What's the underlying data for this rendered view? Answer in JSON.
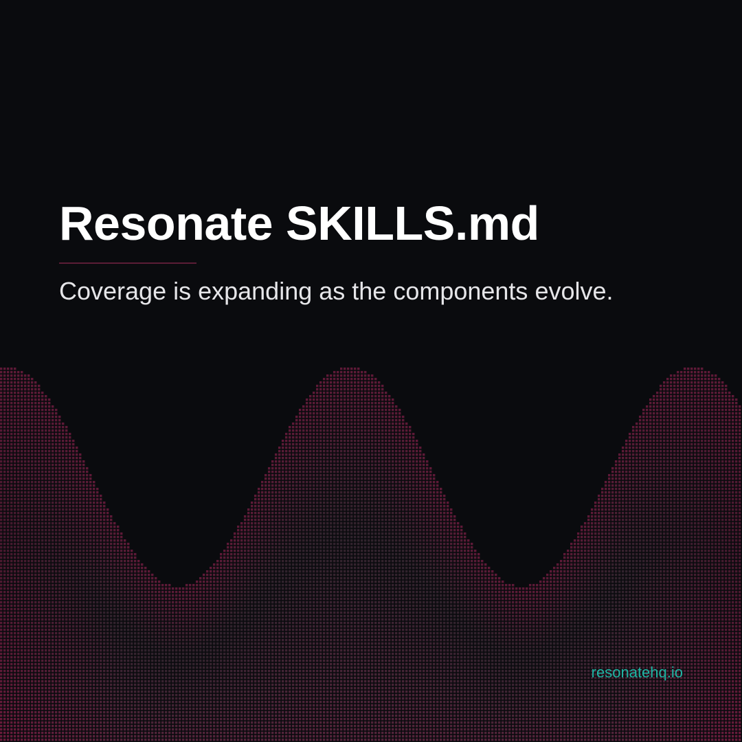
{
  "slide": {
    "title": "Resonate SKILLS.md",
    "subtitle": "Coverage is expanding as the components evolve.",
    "site_link": "resonatehq.io"
  },
  "colors": {
    "background": "#0a0b0e",
    "title": "#ffffff",
    "subtitle": "#e6e6e9",
    "divider": "#5b1d36",
    "link": "#1fb5a3",
    "dot_accent": "#b31f5a",
    "dot_neutral": "#4a4d55"
  }
}
